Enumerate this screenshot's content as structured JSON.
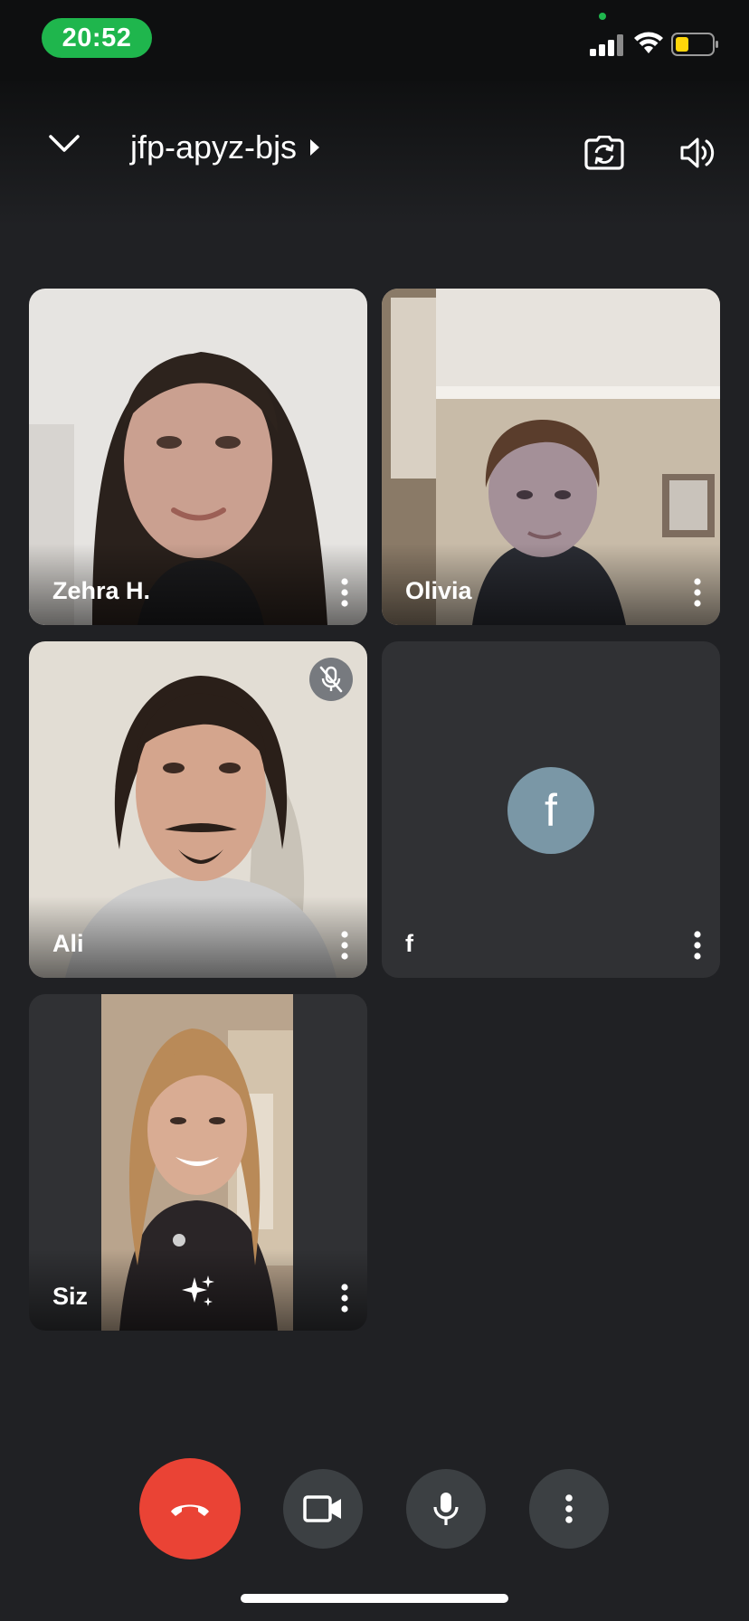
{
  "status_bar": {
    "time": "20:52",
    "time_pill_color": "#1fb64d",
    "battery_color": "#ffd60a",
    "icons": [
      "signal-icon",
      "wifi-icon",
      "battery-icon"
    ]
  },
  "header": {
    "meeting_code": "jfp-apyz-bjs",
    "icons": [
      "chevron-down-icon",
      "triangle-right-icon",
      "switch-camera-icon",
      "speaker-icon"
    ]
  },
  "participants": [
    {
      "name": "Zehra H.",
      "video_on": true,
      "muted": false
    },
    {
      "name": "Olivia",
      "video_on": true,
      "muted": false
    },
    {
      "name": "Ali",
      "video_on": true,
      "muted": true
    },
    {
      "name": "f",
      "video_on": false,
      "avatar_letter": "f",
      "avatar_color": "#7a97a6"
    },
    {
      "name": "Siz",
      "video_on": true,
      "self": true
    }
  ],
  "controls": {
    "end_call_color": "#ea4335",
    "icons": [
      "end-call-icon",
      "camera-icon",
      "microphone-icon",
      "more-vertical-icon"
    ]
  }
}
